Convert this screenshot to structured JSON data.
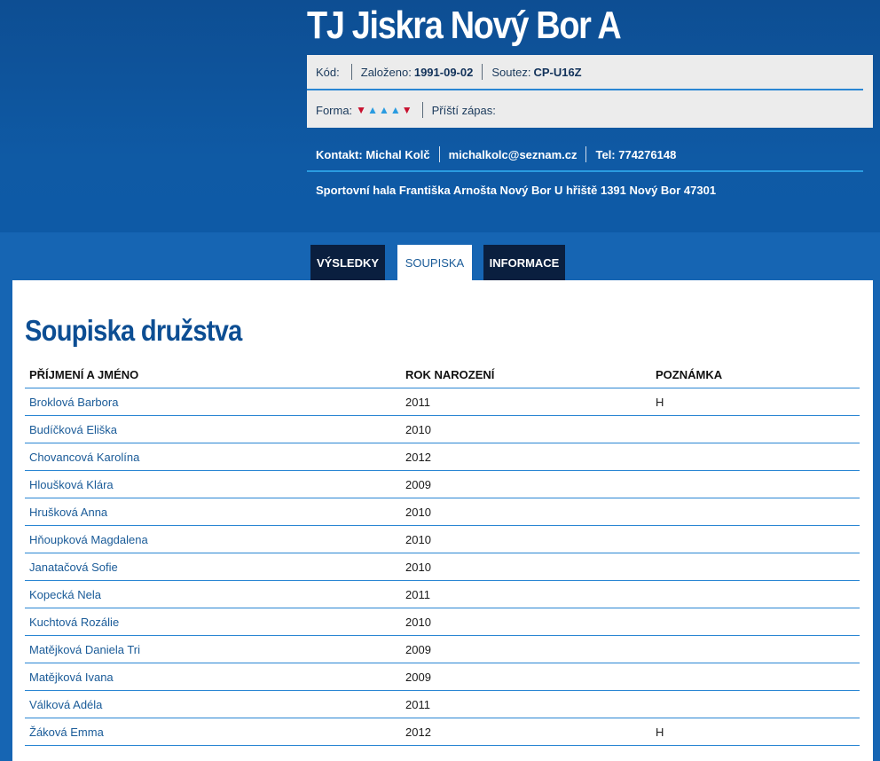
{
  "team": {
    "name": "TJ Jiskra Nový Bor A"
  },
  "info": {
    "kod_label": "Kód:",
    "kod_value": "",
    "zalozeno_label": "Založeno:",
    "zalozeno_value": "1991-09-02",
    "soutez_label": "Soutez:",
    "soutez_value": "CP-U16Z",
    "forma_label": "Forma:",
    "forma": [
      "down",
      "up",
      "up",
      "up",
      "down"
    ],
    "dalsi_zapas_label": "Příští zápas:",
    "colors": {
      "loss": "#c8102e",
      "win": "#2a9be0"
    }
  },
  "contact": {
    "kontakt": "Kontakt: Michal Kolč",
    "email": "michalkolc@seznam.cz",
    "tel": "Tel: 774276148",
    "address": "Sportovní hala Františka Arnošta Nový Bor   U hřiště 1391 Nový Bor   47301"
  },
  "tabs": [
    {
      "label": "VÝSLEDKY"
    },
    {
      "label": "SOUPISKA"
    },
    {
      "label": "INFORMACE"
    }
  ],
  "section": {
    "title": "Soupiska družstva"
  },
  "table": {
    "headers": [
      "PŘÍJMENÍ A JMÉNO",
      "ROK NAROZENÍ",
      "POZNÁMKA"
    ],
    "rows": [
      {
        "name": "Broklová Barbora",
        "year": "2011",
        "note": "H"
      },
      {
        "name": "Budíčková Eliška",
        "year": "2010",
        "note": ""
      },
      {
        "name": "Chovancová Karolína",
        "year": "2012",
        "note": ""
      },
      {
        "name": "Hloušková Klára",
        "year": "2009",
        "note": ""
      },
      {
        "name": "Hrušková Anna",
        "year": "2010",
        "note": ""
      },
      {
        "name": "Hňoupková Magdalena",
        "year": "2010",
        "note": ""
      },
      {
        "name": "Janatačová Sofie",
        "year": "2010",
        "note": ""
      },
      {
        "name": "Kopecká Nela",
        "year": "2011",
        "note": ""
      },
      {
        "name": "Kuchtová Rozálie",
        "year": "2010",
        "note": ""
      },
      {
        "name": "Matějková Daniela Tri",
        "year": "2009",
        "note": ""
      },
      {
        "name": "Matějková Ivana",
        "year": "2009",
        "note": ""
      },
      {
        "name": "Válková Adéla",
        "year": "2011",
        "note": ""
      },
      {
        "name": "Žáková Emma",
        "year": "2012",
        "note": "H"
      }
    ]
  }
}
